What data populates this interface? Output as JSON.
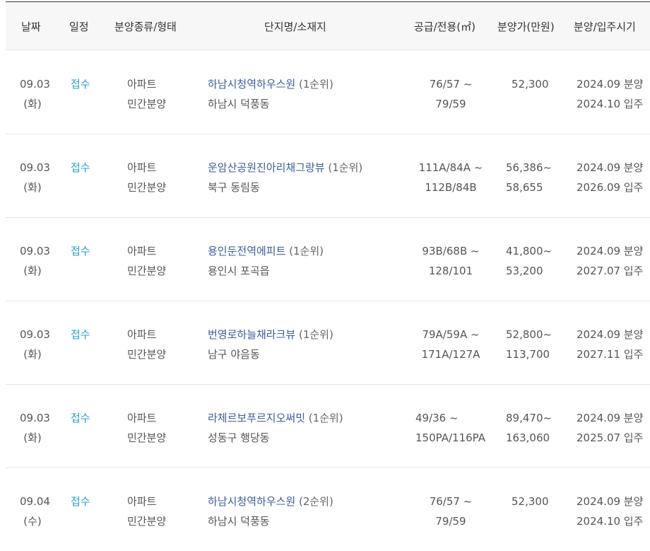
{
  "headers": {
    "date": "날짜",
    "step": "일정",
    "type": "분양종류/형태",
    "complex": "단지명/소재지",
    "area": "공급/전용(㎡)",
    "price": "분양가(만원)",
    "period": "분양/입주시기"
  },
  "rows": [
    {
      "date": "09.03",
      "day": "(화)",
      "step": "접수",
      "kind": "아파트",
      "form": "민간분양",
      "name": "하남시청역하우스원",
      "rank": "(1순위)",
      "location": "하남시 덕풍동",
      "area1": "76/57 ~",
      "area2": "79/59",
      "price1": "52,300",
      "price2": "",
      "sale": "2024.09 분양",
      "move": "2024.10 입주"
    },
    {
      "date": "09.03",
      "day": "(화)",
      "step": "접수",
      "kind": "아파트",
      "form": "민간분양",
      "name": "운암산공원진아리채그랑뷰",
      "rank": "(1순위)",
      "location": "북구 동림동",
      "area1": "111A/84A ~",
      "area2": "112B/84B",
      "price1": "56,386~",
      "price2": "58,655",
      "sale": "2024.09 분양",
      "move": "2026.09 입주"
    },
    {
      "date": "09.03",
      "day": "(화)",
      "step": "접수",
      "kind": "아파트",
      "form": "민간분양",
      "name": "용인둔전역에피트",
      "rank": "(1순위)",
      "location": "용인시 포곡읍",
      "area1": "93B/68B ~",
      "area2": "128/101",
      "price1": "41,800~",
      "price2": "53,200",
      "sale": "2024.09 분양",
      "move": "2027.07 입주"
    },
    {
      "date": "09.03",
      "day": "(화)",
      "step": "접수",
      "kind": "아파트",
      "form": "민간분양",
      "name": "번영로하늘채라크뷰",
      "rank": "(1순위)",
      "location": "남구 야음동",
      "area1": "79A/59A ~",
      "area2": "171A/127A",
      "price1": "52,800~",
      "price2": "113,700",
      "sale": "2024.09 분양",
      "move": "2027.11 입주"
    },
    {
      "date": "09.03",
      "day": "(화)",
      "step": "접수",
      "kind": "아파트",
      "form": "민간분양",
      "name": "라체르보푸르지오써밋",
      "rank": "(1순위)",
      "location": "성동구 행당동",
      "area1": "49/36 ~",
      "area2": "150PA/116PA",
      "price1": "89,470~",
      "price2": "163,060",
      "sale": "2024.09 분양",
      "move": "2025.07 입주"
    },
    {
      "date": "09.04",
      "day": "(수)",
      "step": "접수",
      "kind": "아파트",
      "form": "민간분양",
      "name": "하남시청역하우스원",
      "rank": "(2순위)",
      "location": "하남시 덕풍동",
      "area1": "76/57 ~",
      "area2": "79/59",
      "price1": "52,300",
      "price2": "",
      "sale": "2024.09 분양",
      "move": "2024.10 입주"
    }
  ]
}
